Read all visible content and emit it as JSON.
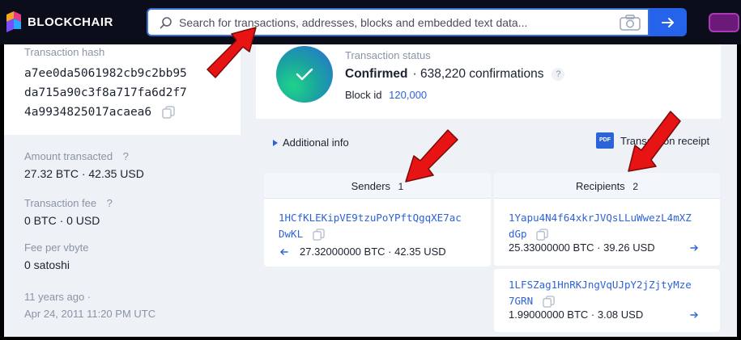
{
  "brand": {
    "name": "BLOCKCHAIR"
  },
  "search": {
    "placeholder": "Search for transactions, addresses, blocks and embedded text data..."
  },
  "left": {
    "hash_label": "Transaction hash",
    "hash_lines": [
      "a7ee0da5061982cb9c2bb95",
      "da715a90c3f8a717fa6d2f7",
      "4a9934825017acaea6"
    ],
    "amount_label": "Amount transacted",
    "amount_help": "?",
    "amount_value": "27.32 BTC · 42.35 USD",
    "fee_label": "Transaction fee",
    "fee_help": "?",
    "fee_value": "0 BTC · 0 USD",
    "fee_vbyte_label": "Fee per vbyte",
    "fee_vbyte_value": "0 satoshi",
    "age": "11 years ago ·",
    "date": "Apr 24, 2011 11:20 PM UTC"
  },
  "status": {
    "label": "Transaction status",
    "state": "Confirmed",
    "confirmations": "· 638,220 confirmations",
    "help": "?",
    "block_label": "Block id",
    "block_value": "120,000"
  },
  "additional_info": "Additional info",
  "receipt": {
    "badge": "PDF",
    "label": "Transaction receipt"
  },
  "senders": {
    "title": "Senders",
    "count": "1",
    "items": [
      {
        "address_lines": [
          "1HCfKLEKipVE9tzuPoYPftQgqXE7ac",
          "DwKL"
        ],
        "amount": "27.32000000 BTC",
        "usd": "· 42.35 USD"
      }
    ]
  },
  "recipients": {
    "title": "Recipients",
    "count": "2",
    "items": [
      {
        "address_lines": [
          "1Yapu4N4f64xkrJVQsLLuWwezL4mXZ",
          "dGp"
        ],
        "amount": "25.33000000 BTC",
        "usd": "· 39.26 USD"
      },
      {
        "address_lines": [
          "1LFSZag1HnRKJngVqUJpY2jZjtyMze",
          "7GRN"
        ],
        "amount": "1.99000000 BTC",
        "usd": "· 3.08 USD"
      }
    ]
  },
  "colors": {
    "accent": "#2563eb",
    "annotation_arrow": "#e81414",
    "link": "#2d63d8"
  }
}
